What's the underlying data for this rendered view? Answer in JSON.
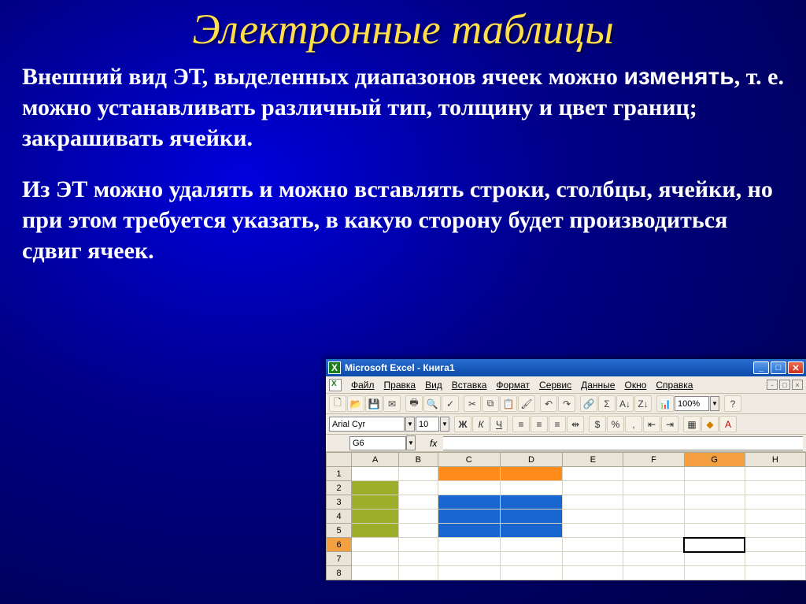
{
  "slide": {
    "title": "Электронные таблицы",
    "para1_a": "Внешний вид ЭТ, выделенных диапазонов ячеек можно ",
    "para1_b": "изменять",
    "para1_c": ", т. е. можно устанавливать различный тип, толщину и цвет границ; закрашивать ячейки.",
    "para2": "Из ЭТ можно удалять и можно вставлять строки, столбцы, ячейки, но при этом требуется указать, в какую сторону будет производиться сдвиг ячеек."
  },
  "excel": {
    "app_title": "Microsoft Excel - Книга1",
    "menus": {
      "file": "Файл",
      "edit": "Правка",
      "view": "Вид",
      "insert": "Вставка",
      "format": "Формат",
      "service": "Сервис",
      "data": "Данные",
      "window": "Окно",
      "help": "Справка"
    },
    "toolbar": {
      "zoom": "100%"
    },
    "format_bar": {
      "font": "Arial Cyr",
      "size": "10",
      "bold": "Ж",
      "italic": "К",
      "underline": "Ч"
    },
    "name_box": "G6",
    "fx_label": "fx",
    "columns": [
      "A",
      "B",
      "C",
      "D",
      "E",
      "F",
      "G",
      "H"
    ],
    "rows": [
      "1",
      "2",
      "3",
      "4",
      "5",
      "6",
      "7",
      "8"
    ],
    "active_row": "6",
    "active_col": "G",
    "filled_cells": {
      "A2": "olive",
      "A3": "olive",
      "A4": "olive",
      "A5": "olive",
      "C1": "orange",
      "D1": "orange",
      "C3": "blue",
      "D3": "blue",
      "C4": "blue",
      "D4": "blue",
      "C5": "blue",
      "D5": "blue"
    }
  }
}
